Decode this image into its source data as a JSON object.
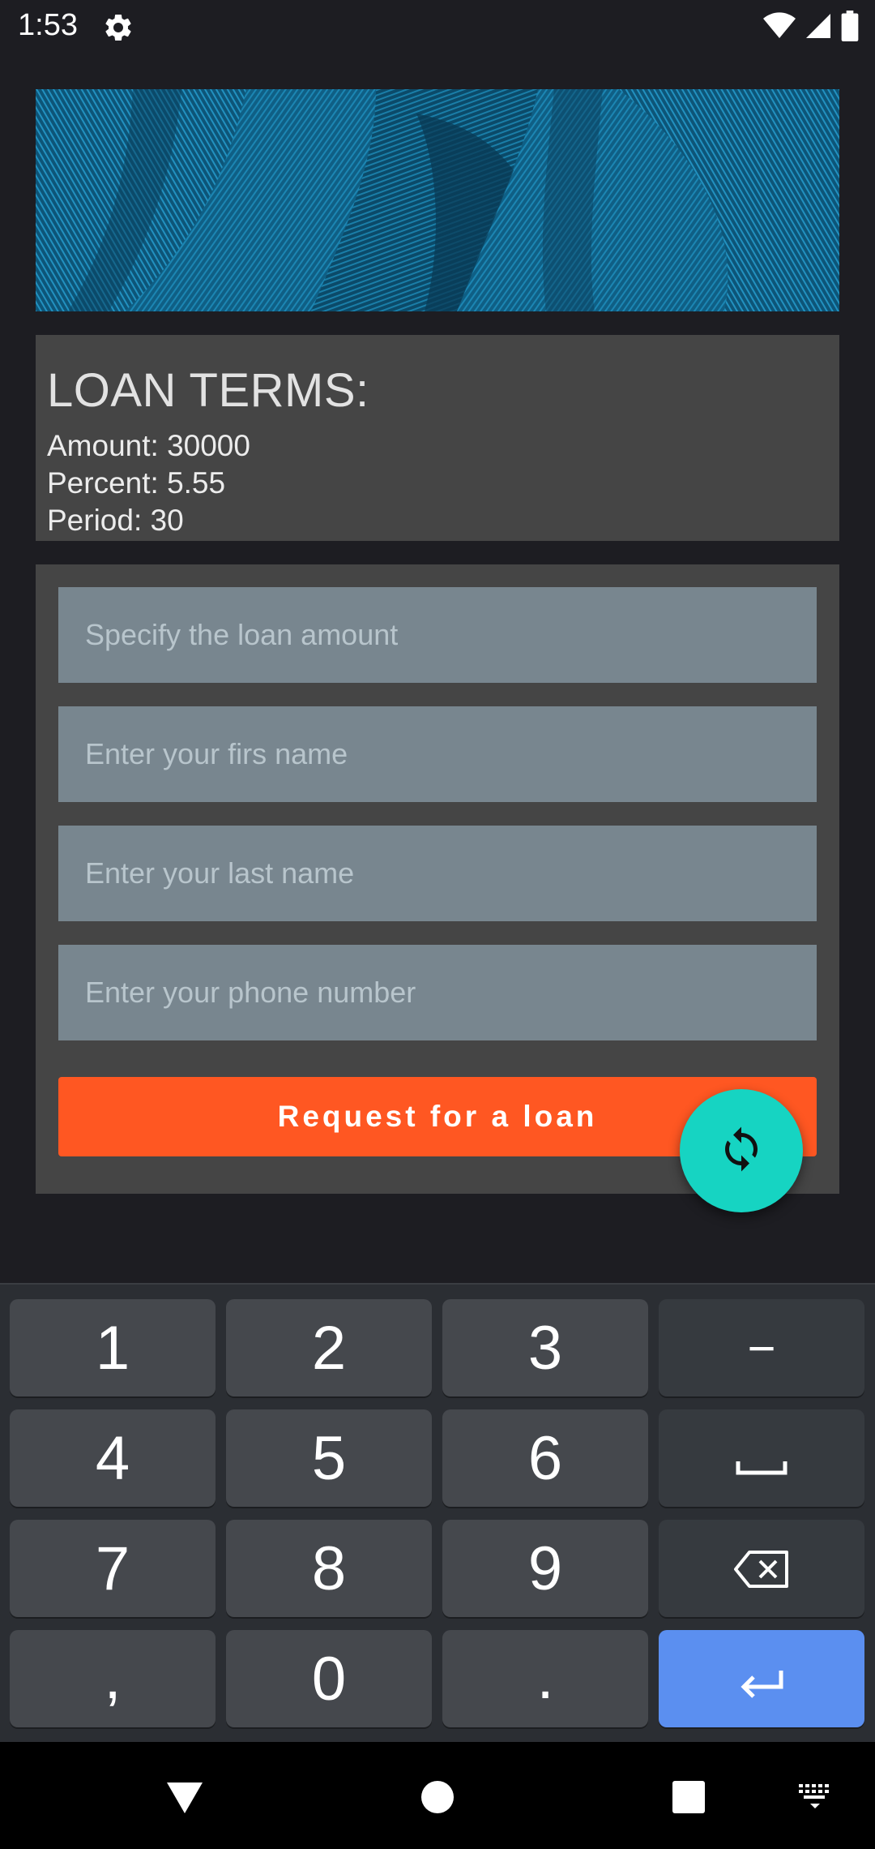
{
  "status_bar": {
    "time": "1:53",
    "icons": [
      "settings-gear-icon",
      "wifi-icon",
      "signal-icon",
      "battery-icon"
    ]
  },
  "header_image": {
    "description_icon": "blue-feather-texture"
  },
  "loan_terms": {
    "title": "LOAN TERMS:",
    "amount": "Amount: 30000",
    "percent": "Percent: 5.55",
    "period": "Period: 30"
  },
  "form": {
    "amount_placeholder": "Specify the loan amount",
    "first_name_placeholder": "Enter your firs name",
    "last_name_placeholder": "Enter your last name",
    "phone_placeholder": "Enter your phone number",
    "submit_label": "Request for a loan"
  },
  "fab": {
    "icon": "refresh-icon"
  },
  "keyboard": {
    "row1": [
      "1",
      "2",
      "3",
      "−"
    ],
    "row2": [
      "4",
      "5",
      "6",
      "space"
    ],
    "row3": [
      "7",
      "8",
      "9",
      "backspace"
    ],
    "row4": [
      ",",
      "0",
      ".",
      "enter"
    ]
  },
  "nav": {
    "buttons": [
      "back-icon",
      "home-icon",
      "recents-icon",
      "keyboard-switch-icon"
    ]
  },
  "colors": {
    "accent": "#ff5722",
    "fab": "#16d4c2",
    "enter_key": "#5b8ff0",
    "card": "#454545",
    "field": "#78868f"
  }
}
